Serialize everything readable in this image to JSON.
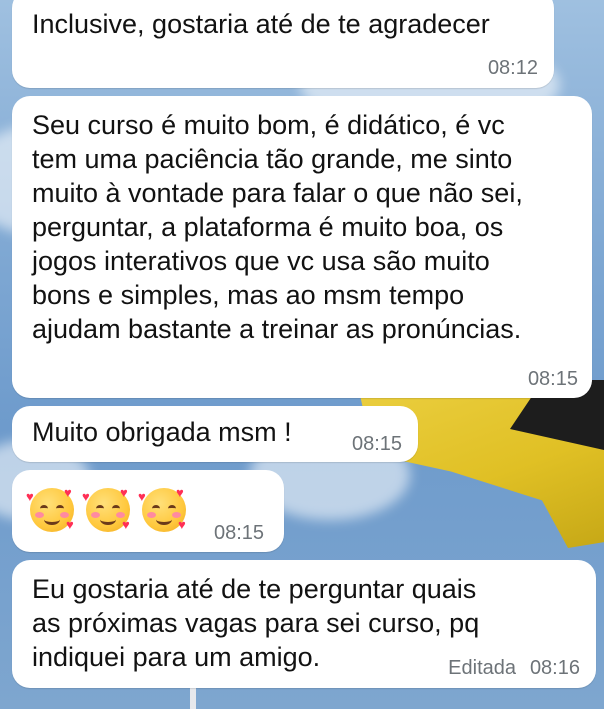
{
  "messages": [
    {
      "text": "Inclusive, gostaria até de te agradecer",
      "time": "08:12"
    },
    {
      "text": "Seu curso é muito bom, é didático, é vc\ntem uma paciência tão grande, me sinto\nmuito à vontade para falar o que não sei,\nperguntar, a plataforma é muito boa, os\njogos interativos que vc usa são muito\nbons e simples, mas ao msm tempo\najudam bastante a treinar as pronúncias.",
      "time": "08:15"
    },
    {
      "text": "Muito obrigada msm !",
      "time": "08:15"
    },
    {
      "emoji": "smiling-face-with-hearts",
      "emoji_count": 3,
      "time": "08:15"
    },
    {
      "text": "Eu gostaria até de te perguntar quais\nas próximas vagas para sei curso, pq\nindiquei para um amigo.",
      "edited_label": "Editada",
      "time": "08:16"
    }
  ],
  "colors": {
    "bubble": "#ffffff",
    "text": "#121212",
    "time": "#6d7378"
  }
}
